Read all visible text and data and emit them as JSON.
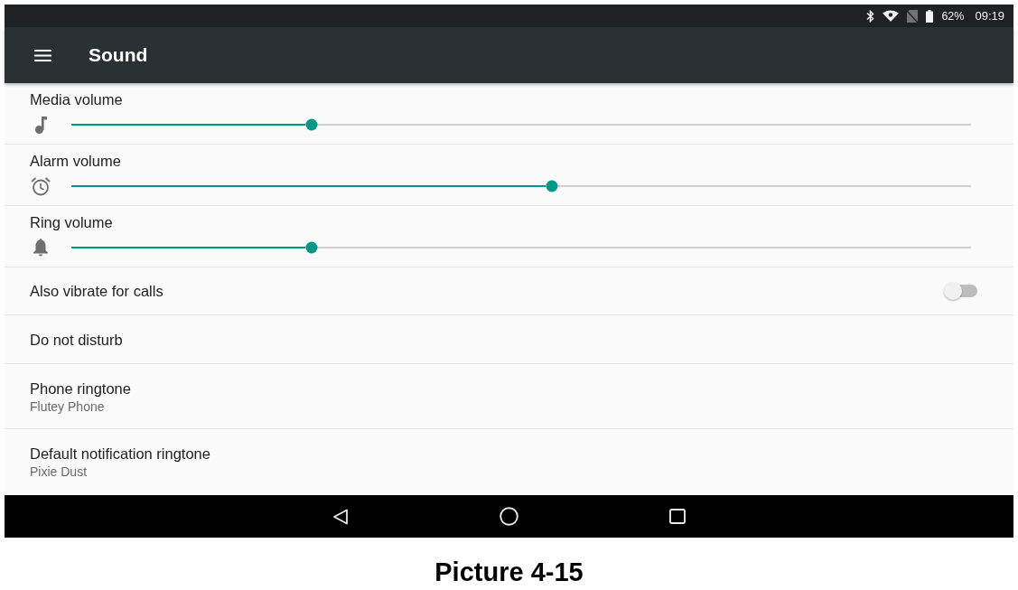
{
  "status_bar": {
    "battery": "62%",
    "time": "09:19"
  },
  "app_bar": {
    "title": "Sound"
  },
  "settings": [
    {
      "kind": "slider",
      "label": "Media volume",
      "level": 0.267
    },
    {
      "kind": "slider",
      "label": "Alarm volume",
      "level": 0.534
    },
    {
      "kind": "slider",
      "label": "Ring volume",
      "level": 0.267
    },
    {
      "kind": "switch",
      "label": "Also vibrate for calls",
      "on": false
    },
    {
      "kind": "plain",
      "label": "Do not disturb"
    },
    {
      "kind": "summary",
      "label": "Phone ringtone",
      "summary": "Flutey Phone"
    },
    {
      "kind": "summary",
      "label": "Default notification ringtone",
      "summary": "Pixie Dust"
    }
  ],
  "caption": "Picture 4-15"
}
